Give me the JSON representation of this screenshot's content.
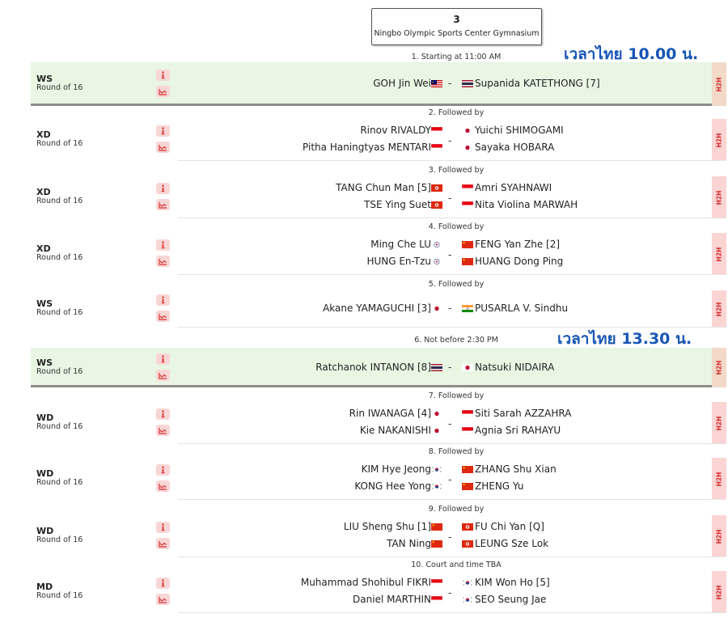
{
  "court": {
    "number": "3",
    "name": "Ningbo Olympic Sports Center Gymnasium"
  },
  "notes": {
    "thai_time_1": "เวลาไทย 10.00 น.",
    "thai_time_2": "เวลาไทย 13.30 น."
  },
  "h2h_label": "H2H",
  "matches": [
    {
      "order": "1. Starting at 11:00 AM",
      "event": "WS",
      "round": "Round of 16",
      "featured": true,
      "left": [
        "GOH Jin Wei"
      ],
      "left_flags": [
        "MAS"
      ],
      "right": [
        "Supanida KATETHONG [7]"
      ],
      "right_flags": [
        "THA"
      ]
    },
    {
      "order": "2. Followed by",
      "event": "XD",
      "round": "Round of 16",
      "left": [
        "Rinov RIVALDY",
        "Pitha Haningtyas MENTARI"
      ],
      "left_flags": [
        "INA",
        "INA"
      ],
      "right": [
        "Yuichi SHIMOGAMI",
        "Sayaka HOBARA"
      ],
      "right_flags": [
        "JPN",
        "JPN"
      ]
    },
    {
      "order": "3. Followed by",
      "event": "XD",
      "round": "Round of 16",
      "left": [
        "TANG Chun Man [5]",
        "TSE Ying Suet"
      ],
      "left_flags": [
        "HKG",
        "HKG"
      ],
      "right": [
        "Amri SYAHNAWI",
        "Nita Violina MARWAH"
      ],
      "right_flags": [
        "INA",
        "INA"
      ]
    },
    {
      "order": "4. Followed by",
      "event": "XD",
      "round": "Round of 16",
      "left": [
        "Ming Che LU",
        "HUNG En-Tzu"
      ],
      "left_flags": [
        "TPE",
        "TPE"
      ],
      "right": [
        "FENG Yan Zhe [2]",
        "HUANG Dong Ping"
      ],
      "right_flags": [
        "CHN",
        "CHN"
      ]
    },
    {
      "order": "5. Followed by",
      "event": "WS",
      "round": "Round of 16",
      "left": [
        "Akane YAMAGUCHI [3]"
      ],
      "left_flags": [
        "JPN"
      ],
      "right": [
        "PUSARLA V. Sindhu"
      ],
      "right_flags": [
        "IND"
      ]
    },
    {
      "order": "6. Not before 2:30 PM",
      "event": "WS",
      "round": "Round of 16",
      "featured": true,
      "left": [
        "Ratchanok INTANON [8]"
      ],
      "left_flags": [
        "THA"
      ],
      "right": [
        "Natsuki NIDAIRA"
      ],
      "right_flags": [
        "JPN"
      ]
    },
    {
      "order": "7. Followed by",
      "event": "WD",
      "round": "Round of 16",
      "left": [
        "Rin IWANAGA [4]",
        "Kie NAKANISHI"
      ],
      "left_flags": [
        "JPN",
        "JPN"
      ],
      "right": [
        "Siti Sarah AZZAHRA",
        "Agnia Sri RAHAYU"
      ],
      "right_flags": [
        "INA",
        "INA"
      ]
    },
    {
      "order": "8. Followed by",
      "event": "WD",
      "round": "Round of 16",
      "left": [
        "KIM Hye Jeong",
        "KONG Hee Yong"
      ],
      "left_flags": [
        "KOR",
        "KOR"
      ],
      "right": [
        "ZHANG Shu Xian",
        "ZHENG Yu"
      ],
      "right_flags": [
        "CHN",
        "CHN"
      ]
    },
    {
      "order": "9. Followed by",
      "event": "WD",
      "round": "Round of 16",
      "left": [
        "LIU Sheng Shu [1]",
        "TAN Ning"
      ],
      "left_flags": [
        "CHN",
        "CHN"
      ],
      "right": [
        "FU Chi Yan [Q]",
        "LEUNG Sze Lok"
      ],
      "right_flags": [
        "HKG",
        "HKG"
      ]
    },
    {
      "order": "10. Court and time TBA",
      "event": "MD",
      "round": "Round of 16",
      "left": [
        "Muhammad Shohibul FIKRI",
        "Daniel MARTHIN"
      ],
      "left_flags": [
        "INA",
        "INA"
      ],
      "right": [
        "KIM Won Ho [5]",
        "SEO Seung Jae"
      ],
      "right_flags": [
        "KOR",
        "KOR"
      ]
    }
  ]
}
